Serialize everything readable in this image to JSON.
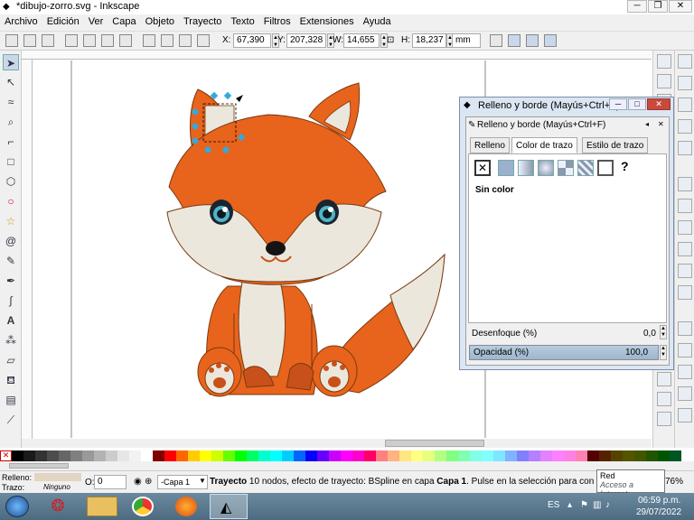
{
  "window": {
    "title": "*dibujo-zorro.svg - Inkscape",
    "controls": {
      "minimize": "─",
      "restore": "❐",
      "close": "✕"
    }
  },
  "menu": [
    "Archivo",
    "Edición",
    "Ver",
    "Capa",
    "Objeto",
    "Trayecto",
    "Texto",
    "Filtros",
    "Extensiones",
    "Ayuda"
  ],
  "controls": {
    "x_label": "X:",
    "x_value": "67,390",
    "y_label": "Y:",
    "y_value": "207,328",
    "w_label": "W:",
    "w_value": "14,655",
    "h_label": "H:",
    "h_value": "18,237",
    "unit": "mm"
  },
  "dialog": {
    "title": "Relleno y borde (Mayús+Ctrl+F)",
    "subtitle": "Relleno y borde (Mayús+Ctrl+F)",
    "tabs": [
      "Relleno",
      "Color de trazo",
      "Estilo de trazo"
    ],
    "active_tab": 1,
    "paint_mode": "Sin color",
    "blur_label": "Desenfoque (%)",
    "blur_value": "0,0",
    "opacity_label": "Opacidad (%)",
    "opacity_value": "100,0",
    "unknown_glyph": "?"
  },
  "status": {
    "fill_label": "Relleno:",
    "stroke_label": "Trazo:",
    "stroke_value": "Ninguno",
    "o_label": "O:",
    "o_value": "0",
    "layer": "-Capa 1",
    "message_bold": "Trayecto",
    "message": "10 nodos, efecto de trayecto: BSpline en capa",
    "message_layer": "Capa 1",
    "message_tail": ". Pulse en la selección para conmutar los tira...",
    "zoom": "76%"
  },
  "tooltip": {
    "line1": "Red",
    "line2": "Acceso a Internet"
  },
  "taskbar": {
    "lang": "ES",
    "time": "06:59 p.m.",
    "date": "29/07/2022"
  },
  "colors": {
    "fox_orange": "#e8631c",
    "fox_dark": "#c8501a",
    "cream": "#ece7dc",
    "selection": "#33aadd"
  }
}
